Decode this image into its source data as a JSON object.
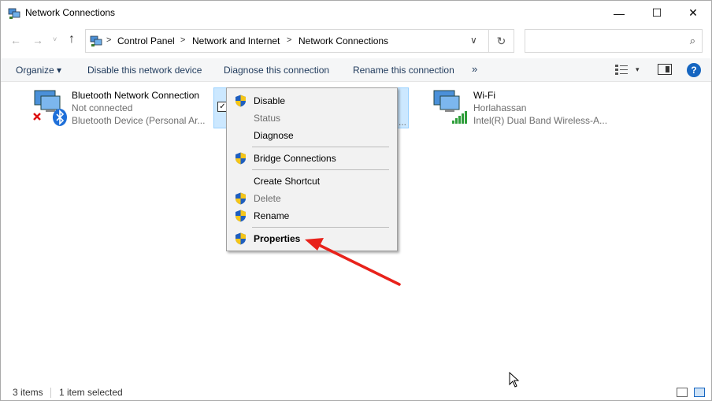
{
  "window": {
    "title": "Network Connections",
    "min_glyph": "—",
    "max_glyph": "☐",
    "close_glyph": "✕"
  },
  "address": {
    "back_glyph": "←",
    "forward_glyph": "→",
    "dropdown_glyph": "˅",
    "up_glyph": "↑",
    "separator": ">",
    "breadcrumbs": [
      "Control Panel",
      "Network and Internet",
      "Network Connections"
    ],
    "chevron_glyph": "∨",
    "refresh_glyph": "↻",
    "search_placeholder": "",
    "search_glyph": "⌕"
  },
  "toolbar": {
    "organize": "Organize ▾",
    "disable": "Disable this network device",
    "diagnose": "Diagnose this connection",
    "rename": "Rename this connection",
    "more": "»",
    "view_drop": "▾",
    "help": "?"
  },
  "items": [
    {
      "name": "Bluetooth Network Connection",
      "status": "Not connected",
      "device": "Bluetooth Device (Personal Ar..."
    },
    {
      "dots": "..."
    },
    {
      "name": "Wi-Fi",
      "status": "Horlahassan",
      "device": "Intel(R) Dual Band Wireless-A..."
    }
  ],
  "context_menu": {
    "check_glyph": "✓",
    "items": [
      {
        "label": "Disable",
        "shield": true,
        "disabled": false
      },
      {
        "label": "Status",
        "shield": false,
        "disabled": true
      },
      {
        "label": "Diagnose",
        "shield": false,
        "disabled": false
      },
      {
        "label": "Bridge Connections",
        "shield": true,
        "disabled": false
      },
      {
        "label": "Create Shortcut",
        "shield": false,
        "disabled": false
      },
      {
        "label": "Delete",
        "shield": true,
        "disabled": true
      },
      {
        "label": "Rename",
        "shield": true,
        "disabled": false
      },
      {
        "label": "Properties",
        "shield": true,
        "disabled": false,
        "bold": true
      }
    ]
  },
  "status_bar": {
    "item_count": "3 items",
    "selected": "1 item selected"
  },
  "colors": {
    "selection_bg": "#cce8ff",
    "menu_bg": "#f2f2f2",
    "arrow": "#e8221b",
    "help_blue": "#1565c0"
  }
}
